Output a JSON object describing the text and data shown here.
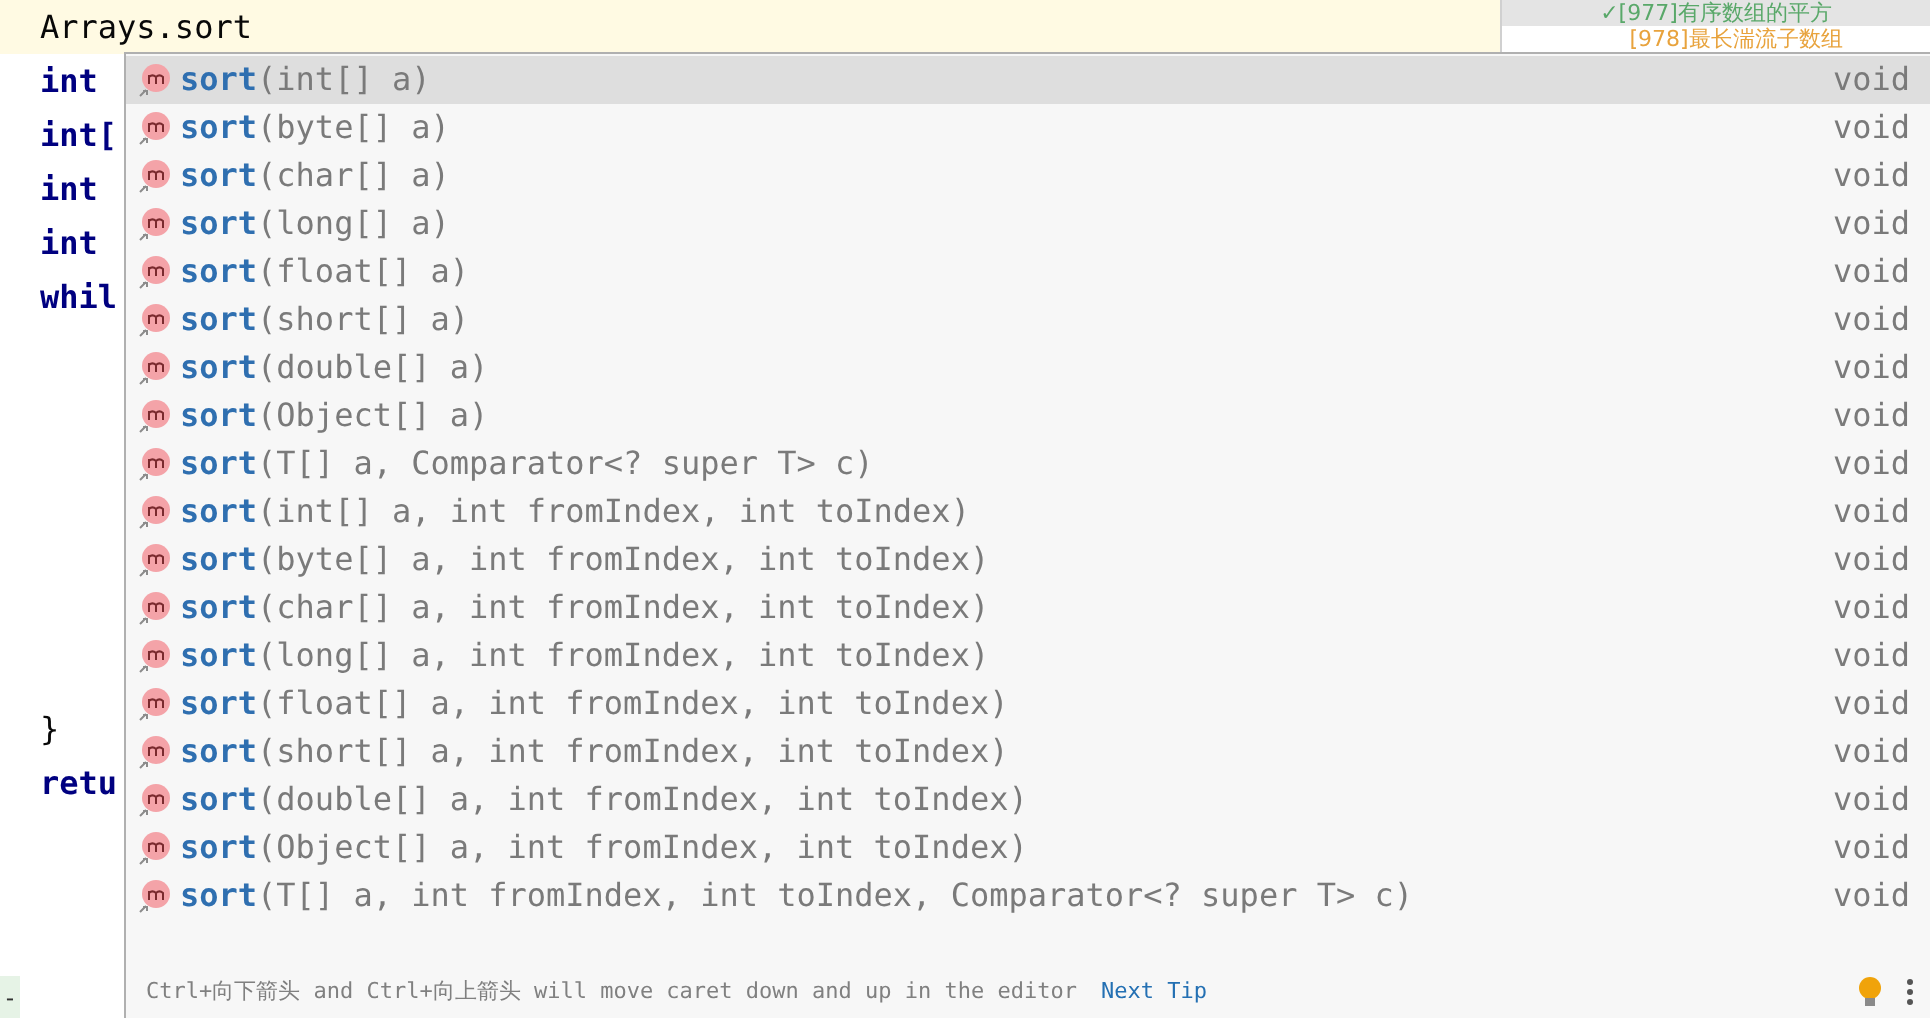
{
  "editor": {
    "lines": [
      {
        "text": "Arrays.sort",
        "kind": "plain",
        "current": true
      },
      {
        "text": "int",
        "kind": "keyword",
        "current": false
      },
      {
        "text": "int[",
        "kind": "keyword",
        "current": false
      },
      {
        "text": "int",
        "kind": "keyword",
        "current": false
      },
      {
        "text": "int",
        "kind": "keyword",
        "current": false
      },
      {
        "text": "whil",
        "kind": "keyword",
        "current": false
      }
    ],
    "lines_after": [
      {
        "text": "}",
        "kind": "plain",
        "current": false
      },
      {
        "text": "retu",
        "kind": "keyword",
        "current": false
      }
    ],
    "gutter_mark": "-"
  },
  "side_panel": {
    "items": [
      {
        "text": "✓[977]有序数组的平方",
        "color": "#59a869"
      },
      {
        "text": "[978]最长湍流子数组",
        "color": "#e8a33d"
      }
    ]
  },
  "popup": {
    "items": [
      {
        "name": "sort",
        "params": "(int[] a)",
        "type": "void",
        "selected": true
      },
      {
        "name": "sort",
        "params": "(byte[] a)",
        "type": "void",
        "selected": false
      },
      {
        "name": "sort",
        "params": "(char[] a)",
        "type": "void",
        "selected": false
      },
      {
        "name": "sort",
        "params": "(long[] a)",
        "type": "void",
        "selected": false
      },
      {
        "name": "sort",
        "params": "(float[] a)",
        "type": "void",
        "selected": false
      },
      {
        "name": "sort",
        "params": "(short[] a)",
        "type": "void",
        "selected": false
      },
      {
        "name": "sort",
        "params": "(double[] a)",
        "type": "void",
        "selected": false
      },
      {
        "name": "sort",
        "params": "(Object[] a)",
        "type": "void",
        "selected": false
      },
      {
        "name": "sort",
        "params": "(T[] a, Comparator<? super T> c)",
        "type": "void",
        "selected": false
      },
      {
        "name": "sort",
        "params": "(int[] a, int fromIndex, int toIndex)",
        "type": "void",
        "selected": false
      },
      {
        "name": "sort",
        "params": "(byte[] a, int fromIndex, int toIndex)",
        "type": "void",
        "selected": false
      },
      {
        "name": "sort",
        "params": "(char[] a, int fromIndex, int toIndex)",
        "type": "void",
        "selected": false
      },
      {
        "name": "sort",
        "params": "(long[] a, int fromIndex, int toIndex)",
        "type": "void",
        "selected": false
      },
      {
        "name": "sort",
        "params": "(float[] a, int fromIndex, int toIndex)",
        "type": "void",
        "selected": false
      },
      {
        "name": "sort",
        "params": "(short[] a, int fromIndex, int toIndex)",
        "type": "void",
        "selected": false
      },
      {
        "name": "sort",
        "params": "(double[] a, int fromIndex, int toIndex)",
        "type": "void",
        "selected": false
      },
      {
        "name": "sort",
        "params": "(Object[] a, int fromIndex, int toIndex)",
        "type": "void",
        "selected": false
      },
      {
        "name": "sort",
        "params": "(T[] a, int fromIndex, int toIndex, Comparator<? super T> c)",
        "type": "void",
        "selected": false
      }
    ],
    "hint": {
      "text": "Ctrl+向下箭头 and Ctrl+向上箭头 will move caret down and up in the editor",
      "link": "Next Tip"
    }
  }
}
